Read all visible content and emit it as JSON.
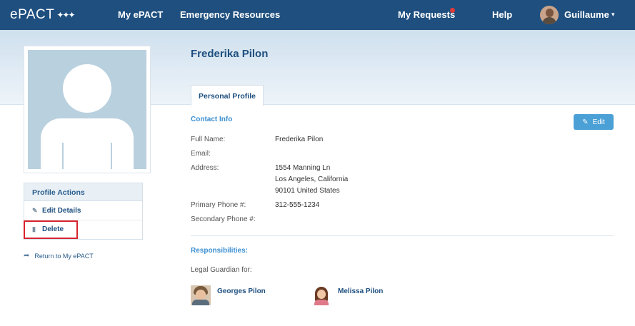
{
  "nav": {
    "logo": "ePACT",
    "items": [
      "My ePACT",
      "Emergency Resources",
      "My Requests",
      "Help"
    ],
    "user_name": "Guillaume",
    "caret": "▾"
  },
  "profile": {
    "name": "Frederika Pilon",
    "tab": "Personal Profile"
  },
  "sidebar": {
    "actions_title": "Profile Actions",
    "edit_label": "Edit Details",
    "delete_label": "Delete",
    "return_label": "Return to My ePACT"
  },
  "contact": {
    "title": "Contact Info",
    "edit_label": "Edit",
    "full_name_label": "Full Name:",
    "full_name": "Frederika Pilon",
    "email_label": "Email:",
    "address_label": "Address:",
    "address_line1": "1554 Manning Ln",
    "address_line2": "Los Angeles, California",
    "address_line3": "90101 United States",
    "primary_phone_label": "Primary Phone #:",
    "primary_phone": "312-555-1234",
    "secondary_phone_label": "Secondary Phone #:"
  },
  "responsibilities": {
    "title": "Responsibilities:",
    "guardian_label": "Legal Guardian for:",
    "children": [
      "Georges Pilon",
      "Melissa Pilon"
    ]
  },
  "colors": {
    "nav_bg": "#1e4f7f",
    "accent": "#3b8fd2",
    "highlight_box": "#d9232e",
    "notification_dot": "#e03a3a"
  },
  "icons": {
    "logo_stars": "stars-icon",
    "edit": "pencil-icon",
    "edit_details": "edit-square-icon",
    "delete": "trash-icon",
    "return": "arrow-icon"
  }
}
